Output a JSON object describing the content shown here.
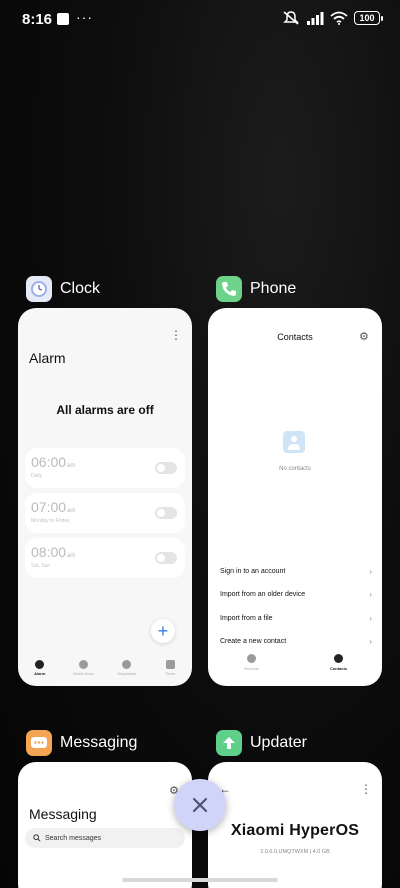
{
  "status_bar": {
    "time": "8:16",
    "dots": "···",
    "battery": "100"
  },
  "recents": {
    "apps": [
      {
        "name": "Clock",
        "icon": "clock-icon",
        "icon_color": "#e6eaf7",
        "card": {
          "title": "Alarm",
          "empty_message": "All alarms are off",
          "alarms": [
            {
              "time": "06:00",
              "ampm": "am",
              "sub": "Daily"
            },
            {
              "time": "07:00",
              "ampm": "am",
              "sub": "Monday to Friday"
            },
            {
              "time": "08:00",
              "ampm": "am",
              "sub": "Sat, Sun"
            }
          ],
          "fab": "+",
          "nav": [
            {
              "label": "Alarm",
              "icon": "alarm-icon",
              "active": true
            },
            {
              "label": "World clock",
              "icon": "world-clock-icon",
              "active": false
            },
            {
              "label": "Stopwatch",
              "icon": "stopwatch-icon",
              "active": false
            },
            {
              "label": "Timer",
              "icon": "timer-icon",
              "active": false
            }
          ]
        }
      },
      {
        "name": "Phone",
        "icon": "phone-icon",
        "icon_color": "#6dd28a",
        "card": {
          "title": "Contacts",
          "empty_message": "No contacts",
          "menu": [
            {
              "label": "Sign in to an account"
            },
            {
              "label": "Import from an older device"
            },
            {
              "label": "Import from a file"
            },
            {
              "label": "Create a new contact"
            }
          ],
          "nav": [
            {
              "label": "Recents",
              "icon": "recents-icon",
              "active": false
            },
            {
              "label": "Contacts",
              "icon": "contacts-icon",
              "active": true
            }
          ]
        }
      },
      {
        "name": "Messaging",
        "icon": "messaging-icon",
        "icon_color": "#f4a553",
        "card": {
          "title": "Messaging",
          "search_placeholder": "Search messages"
        }
      },
      {
        "name": "Updater",
        "icon": "updater-icon",
        "icon_color": "#5fd08a",
        "card": {
          "brand": "Xiaomi HyperOS",
          "version": "2.0.6.0.UMQTWXM | 4.0 GB"
        }
      }
    ]
  },
  "close_all": {
    "icon": "close-icon"
  }
}
